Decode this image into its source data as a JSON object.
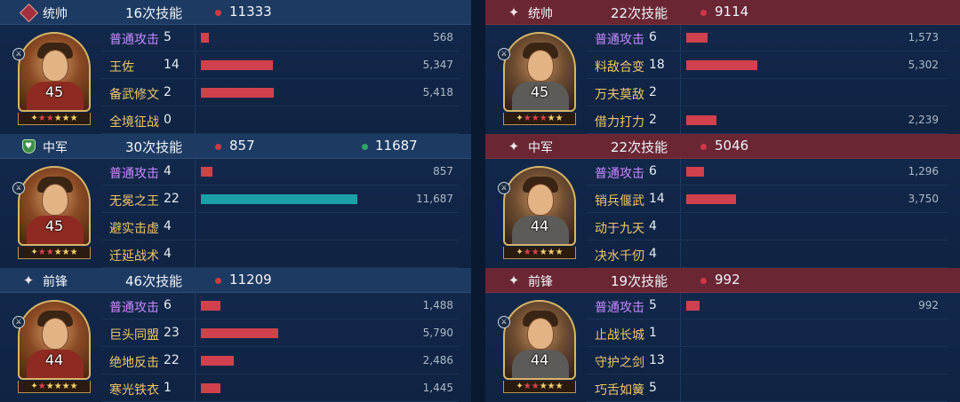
{
  "colors": {
    "damage": "#d0414d",
    "heal": "#1ba0a8"
  },
  "bar_scale_max": 11687,
  "teams": [
    {
      "side": "left",
      "sections": [
        {
          "role": "统帅",
          "badge": "diamond",
          "skills": "16次技能",
          "damage_total": "11333",
          "heal_total": null,
          "level": "45",
          "stars": "2 red, 3 gold",
          "rows": [
            {
              "name": "普通攻击",
              "normal": true,
              "count": "5",
              "value": "568",
              "value_num": 568,
              "type": "damage"
            },
            {
              "name": "王佐",
              "normal": false,
              "count": "14",
              "value": "5,347",
              "value_num": 5347,
              "type": "damage"
            },
            {
              "name": "备武修文",
              "normal": false,
              "count": "2",
              "value": "5,418",
              "value_num": 5418,
              "type": "damage"
            },
            {
              "name": "全境征战",
              "normal": false,
              "count": "0",
              "value": "",
              "value_num": 0,
              "type": "damage"
            }
          ]
        },
        {
          "role": "中军",
          "badge": "shield",
          "skills": "30次技能",
          "damage_total": "857",
          "heal_total": "11687",
          "level": "45",
          "stars": "2 red, 3 gold",
          "rows": [
            {
              "name": "普通攻击",
              "normal": true,
              "count": "4",
              "value": "857",
              "value_num": 857,
              "type": "damage"
            },
            {
              "name": "无冕之王",
              "normal": false,
              "count": "22",
              "value": "11,687",
              "value_num": 11687,
              "type": "heal"
            },
            {
              "name": "避实击虚",
              "normal": false,
              "count": "4",
              "value": "",
              "value_num": 0,
              "type": "damage"
            },
            {
              "name": "迁延战术",
              "normal": false,
              "count": "4",
              "value": "",
              "value_num": 0,
              "type": "damage"
            }
          ]
        },
        {
          "role": "前锋",
          "badge": "star",
          "skills": "46次技能",
          "damage_total": "11209",
          "heal_total": null,
          "level": "44",
          "stars": "1 red, 4 gold",
          "rows": [
            {
              "name": "普通攻击",
              "normal": true,
              "count": "6",
              "value": "1,488",
              "value_num": 1488,
              "type": "damage"
            },
            {
              "name": "巨头同盟",
              "normal": false,
              "count": "23",
              "value": "5,790",
              "value_num": 5790,
              "type": "damage"
            },
            {
              "name": "绝地反击",
              "normal": false,
              "count": "22",
              "value": "2,486",
              "value_num": 2486,
              "type": "damage"
            },
            {
              "name": "寒光铁衣",
              "normal": false,
              "count": "1",
              "value": "1,445",
              "value_num": 1445,
              "type": "damage"
            }
          ]
        }
      ]
    },
    {
      "side": "right",
      "sections": [
        {
          "role": "统帅",
          "badge": "star",
          "skills": "22次技能",
          "damage_total": "9114",
          "heal_total": null,
          "level": "45",
          "stars": "3 red, 2 gold",
          "rows": [
            {
              "name": "普通攻击",
              "normal": true,
              "count": "6",
              "value": "1,573",
              "value_num": 1573,
              "type": "damage"
            },
            {
              "name": "料敌合变",
              "normal": false,
              "count": "18",
              "value": "5,302",
              "value_num": 5302,
              "type": "damage"
            },
            {
              "name": "万夫莫敌",
              "normal": false,
              "count": "2",
              "value": "",
              "value_num": 0,
              "type": "damage"
            },
            {
              "name": "借力打力",
              "normal": false,
              "count": "2",
              "value": "2,239",
              "value_num": 2239,
              "type": "damage"
            }
          ]
        },
        {
          "role": "中军",
          "badge": "star",
          "skills": "22次技能",
          "damage_total": "5046",
          "heal_total": null,
          "level": "44",
          "stars": "2 red, 3 gold",
          "rows": [
            {
              "name": "普通攻击",
              "normal": true,
              "count": "6",
              "value": "1,296",
              "value_num": 1296,
              "type": "damage"
            },
            {
              "name": "销兵偃武",
              "normal": false,
              "count": "14",
              "value": "3,750",
              "value_num": 3750,
              "type": "damage"
            },
            {
              "name": "动于九天",
              "normal": false,
              "count": "4",
              "value": "",
              "value_num": 0,
              "type": "damage"
            },
            {
              "name": "决水千仞",
              "normal": false,
              "count": "4",
              "value": "",
              "value_num": 0,
              "type": "damage"
            }
          ]
        },
        {
          "role": "前锋",
          "badge": "star",
          "skills": "19次技能",
          "damage_total": "992",
          "heal_total": null,
          "level": "44",
          "stars": "2 red, 3 gold",
          "rows": [
            {
              "name": "普通攻击",
              "normal": true,
              "count": "5",
              "value": "992",
              "value_num": 992,
              "type": "damage"
            },
            {
              "name": "止战长城",
              "normal": false,
              "count": "1",
              "value": "",
              "value_num": 0,
              "type": "damage"
            },
            {
              "name": "守护之剑",
              "normal": false,
              "count": "13",
              "value": "",
              "value_num": 0,
              "type": "damage"
            },
            {
              "name": "巧舌如簧",
              "normal": false,
              "count": "5",
              "value": "",
              "value_num": 0,
              "type": "damage"
            }
          ]
        }
      ]
    }
  ]
}
